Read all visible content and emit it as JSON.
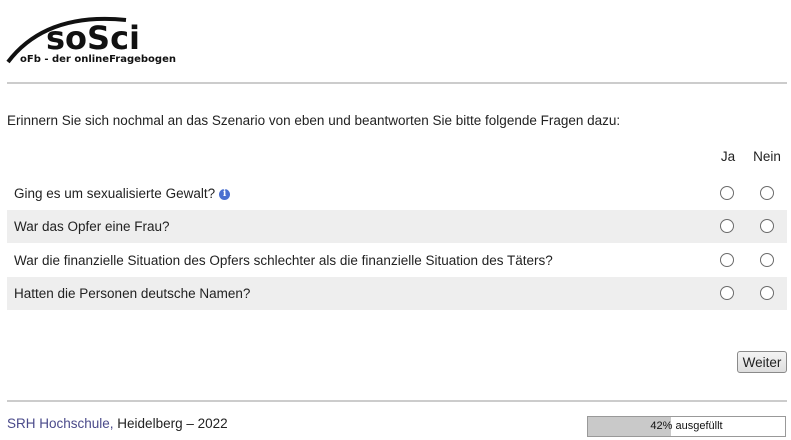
{
  "logo": {
    "name": "soSci",
    "subtitle": "oFb - der onlineFragebogen"
  },
  "intro": "Erinnern Sie sich nochmal an das Szenario von eben und beantworten Sie bitte folgende Fragen dazu:",
  "columns": {
    "yes": "Ja",
    "no": "Nein"
  },
  "questions": [
    {
      "text": "Ging es um sexualisierte Gewalt?",
      "info_icon": "info-icon"
    },
    {
      "text": "War das Opfer eine Frau?"
    },
    {
      "text": "War die finanzielle Situation des Opfers schlechter als die finanzielle Situation des Täters?"
    },
    {
      "text": "Hatten die Personen deutsche Namen?"
    }
  ],
  "next_button": "Weiter",
  "footer": {
    "institution": "SRH Hochschule,",
    "place_year": " Heidelberg – 2022"
  },
  "progress": {
    "percent": 42,
    "label": "42% ausgefüllt"
  },
  "colors": {
    "row_alt": "#eeeeee",
    "link": "#4a4a8a",
    "progress_fill": "#c9c9c9",
    "info": "#4a6fd0"
  }
}
